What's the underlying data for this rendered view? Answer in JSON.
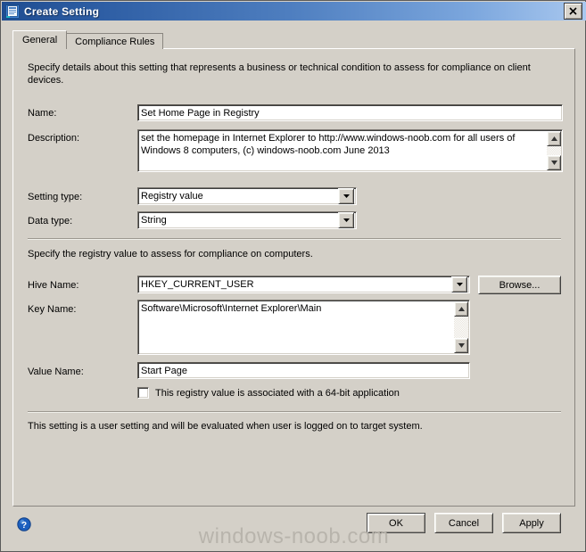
{
  "window": {
    "title": "Create Setting",
    "icon": "setting-document-icon",
    "close_label": "✕"
  },
  "tabs": [
    {
      "label": "General",
      "active": true
    },
    {
      "label": "Compliance Rules",
      "active": false
    }
  ],
  "general": {
    "intro_text": "Specify details about this setting that represents a business or technical condition to assess for compliance on client devices.",
    "name": {
      "label": "Name:",
      "value": "Set Home Page in Registry",
      "placeholder": ""
    },
    "description": {
      "label": "Description:",
      "value": "set the homepage in Internet Explorer to http://www.windows-noob.com for all users of Windows 8 computers, (c) windows-noob.com June 2013",
      "placeholder": ""
    },
    "setting_type": {
      "label": "Setting type:",
      "value": "Registry value",
      "options": [
        "Registry value"
      ]
    },
    "data_type": {
      "label": "Data type:",
      "value": "String",
      "options": [
        "String"
      ]
    },
    "registry_section_text": "Specify the registry value to assess for compliance on computers.",
    "hive_name": {
      "label": "Hive Name:",
      "value": "HKEY_CURRENT_USER",
      "options": [
        "HKEY_CURRENT_USER"
      ]
    },
    "browse_button": "Browse...",
    "key_name": {
      "label": "Key Name:",
      "value": "Software\\Microsoft\\Internet Explorer\\Main",
      "placeholder": ""
    },
    "value_name": {
      "label": "Value Name:",
      "value": "Start Page",
      "placeholder": ""
    },
    "is_64bit": {
      "label": "This registry value is associated with a 64-bit application",
      "checked": false
    },
    "footer_note": "This setting is a user setting and will be evaluated when user is logged on to target system."
  },
  "footer": {
    "help_icon": "help-question-icon",
    "ok": "OK",
    "cancel": "Cancel",
    "apply": "Apply"
  },
  "watermark": "windows-noob.com",
  "colors": {
    "dialog_face": "#d4d0c8",
    "title_left": "#1f4d91",
    "title_right": "#a9c8ef",
    "text": "#000000",
    "help_blue": "#1c5fbe",
    "watermark": "#b8b4ac"
  }
}
